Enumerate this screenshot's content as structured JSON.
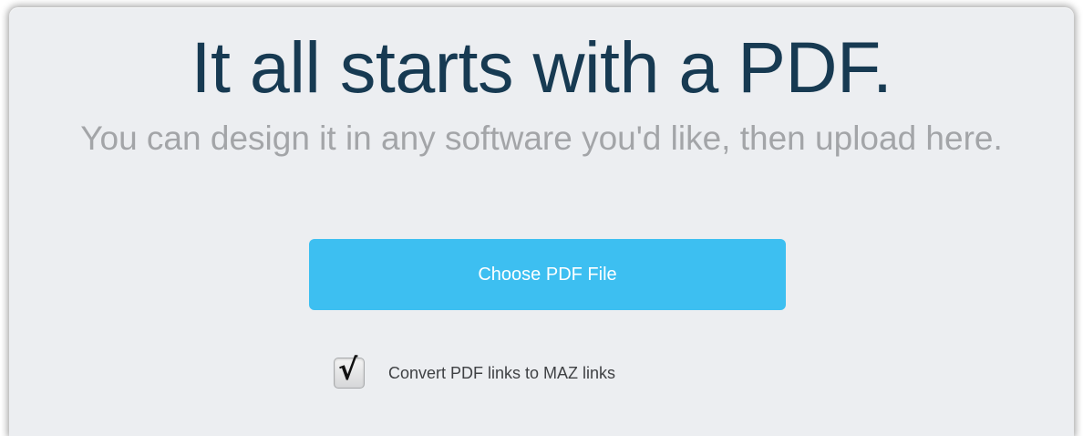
{
  "header": {
    "title": "It all starts with a PDF.",
    "subtitle": "You can design it in any software you'd like, then upload here."
  },
  "upload": {
    "button_label": "Choose PDF File"
  },
  "options": {
    "convert_links": {
      "label": "Convert PDF links to MAZ links",
      "checked": true,
      "checkmark_glyph": "√"
    }
  },
  "colors": {
    "title": "#173a52",
    "subtitle": "#a3a5a8",
    "button": "#3dbff1",
    "panel": "#eceef1"
  }
}
